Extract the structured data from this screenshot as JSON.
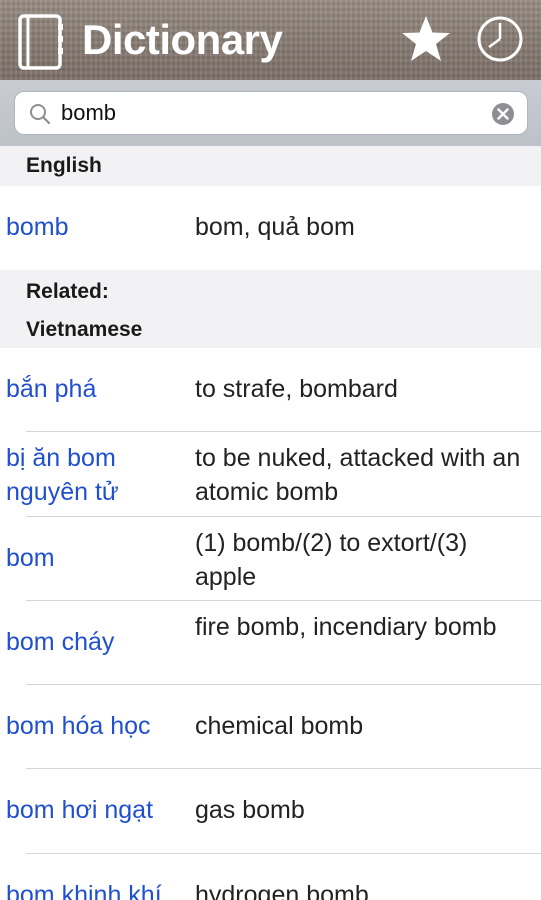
{
  "header": {
    "title": "Dictionary",
    "icons": [
      "book-icon",
      "star-icon",
      "clock-icon"
    ]
  },
  "search": {
    "value": "bomb",
    "placeholder": ""
  },
  "sections": {
    "english": "English",
    "related": "Related:",
    "vietnamese": "Vietnamese"
  },
  "english_results": [
    {
      "term": "bomb",
      "definition": "bom, quả bom"
    }
  ],
  "vietnamese_results": [
    {
      "term": "bắn phá",
      "definition": "to strafe, bombard"
    },
    {
      "term": "bị ăn bom nguyên tử",
      "definition": "to be nuked, attacked with an atomic bomb"
    },
    {
      "term": "bom",
      "definition": "(1) bomb/(2) to extort/(3) apple"
    },
    {
      "term": "bom cháy",
      "definition": "fire bomb, incendiary bomb"
    },
    {
      "term": "bom hóa học",
      "definition": "chemical bomb"
    },
    {
      "term": "bom hơi ngạt",
      "definition": "gas bomb"
    },
    {
      "term": "bom khinh khí",
      "definition": "hydrogen bomb"
    }
  ],
  "colors": {
    "link": "#2050cf",
    "section_bg": "#f2f2f4",
    "header_bg": "#8a7f76"
  }
}
